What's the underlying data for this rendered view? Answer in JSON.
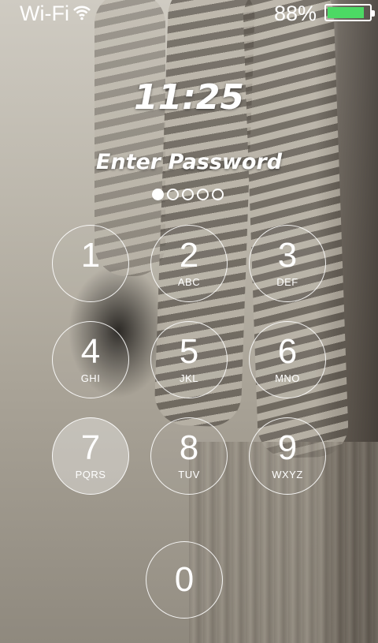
{
  "status_bar": {
    "carrier": "Wi-Fi",
    "wifi_icon": "wifi-icon",
    "battery_percent": "88%",
    "battery_level": 0.88,
    "battery_color": "#4cd964"
  },
  "lock_screen": {
    "time": "11:25",
    "prompt": "Enter Password",
    "passcode_length": 5,
    "digits_entered": 1
  },
  "keypad": [
    {
      "digit": "1",
      "letters": ""
    },
    {
      "digit": "2",
      "letters": "ABC"
    },
    {
      "digit": "3",
      "letters": "DEF"
    },
    {
      "digit": "4",
      "letters": "GHI"
    },
    {
      "digit": "5",
      "letters": "JKL"
    },
    {
      "digit": "6",
      "letters": "MNO"
    },
    {
      "digit": "7",
      "letters": "PQRS"
    },
    {
      "digit": "8",
      "letters": "TUV"
    },
    {
      "digit": "9",
      "letters": "WXYZ"
    },
    {
      "digit": "0",
      "letters": ""
    }
  ]
}
